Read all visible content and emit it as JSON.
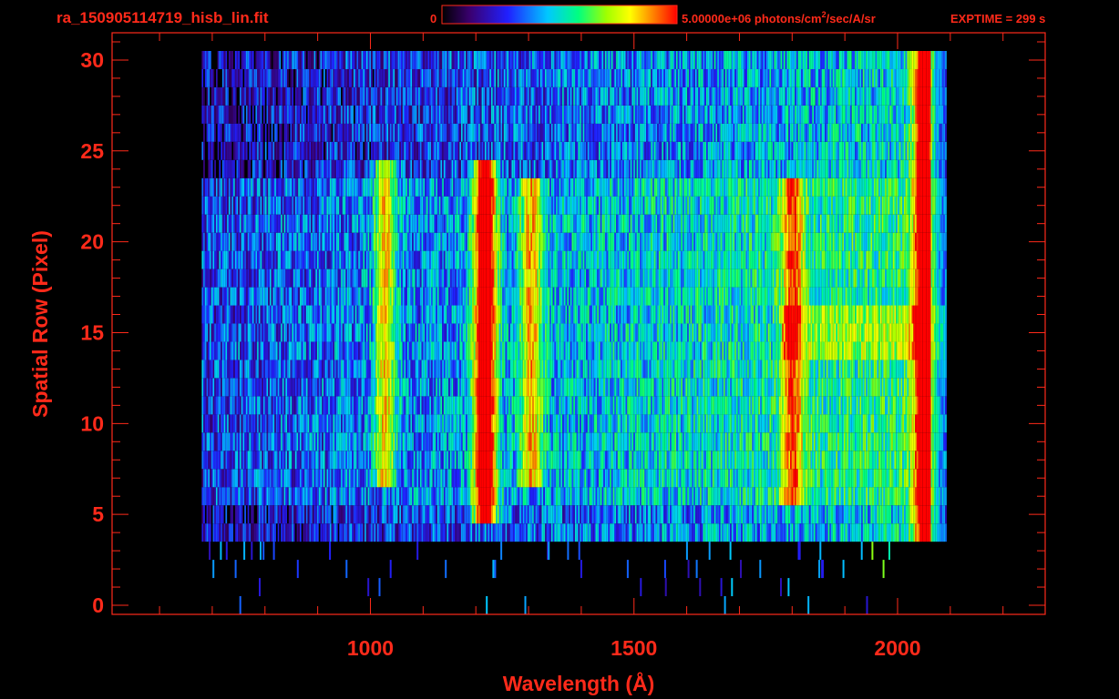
{
  "header": {
    "filename": "ra_150905114719_hisb_lin.fit",
    "colorbar_min_label": "0",
    "colorbar_max_label": "5.00000e+06 photons/cm",
    "colorbar_unit_sup": "2",
    "colorbar_unit_rest": "/sec/A/sr",
    "exptime_label": "EXPTIME = 299 s"
  },
  "colors": {
    "text": "#ff2a1a",
    "axis": "#ff2a1a",
    "background": "#000000",
    "colormap": [
      "#000000",
      "#3a0070",
      "#2020ff",
      "#00c8ff",
      "#00ff80",
      "#a0ff00",
      "#ffff00",
      "#ff8000",
      "#ff0000"
    ]
  },
  "chart_data": {
    "type": "heatmap",
    "title": "ra_150905114719_hisb_lin.fit",
    "xlabel": "Wavelength (Å)",
    "ylabel": "Spatial Row (Pixel)",
    "xlim": [
      510,
      2280
    ],
    "ylim": [
      -0.5,
      31.5
    ],
    "x_ticks": [
      1000,
      1500,
      2000
    ],
    "y_ticks": [
      0,
      5,
      10,
      15,
      20,
      25,
      30
    ],
    "colorbar": {
      "min": 0,
      "max": 5000000,
      "unit": "photons/cm2/sec/A/sr"
    },
    "exptime_s": 299,
    "data_extent": {
      "x": [
        680,
        2060
      ],
      "rows": [
        4,
        30
      ]
    },
    "spectral_features": [
      {
        "x": 1216,
        "rows": [
          5,
          24
        ],
        "peak": 0.95
      },
      {
        "x": 1026,
        "rows": [
          7,
          24
        ],
        "peak": 0.45
      },
      {
        "x": 1304,
        "rows": [
          7,
          23
        ],
        "peak": 0.45
      },
      {
        "x": 1800,
        "rows": [
          6,
          23
        ],
        "peak": 0.5
      },
      {
        "x": 2050,
        "rows": [
          2,
          30
        ],
        "peak": 0.8
      }
    ],
    "grid": false
  }
}
